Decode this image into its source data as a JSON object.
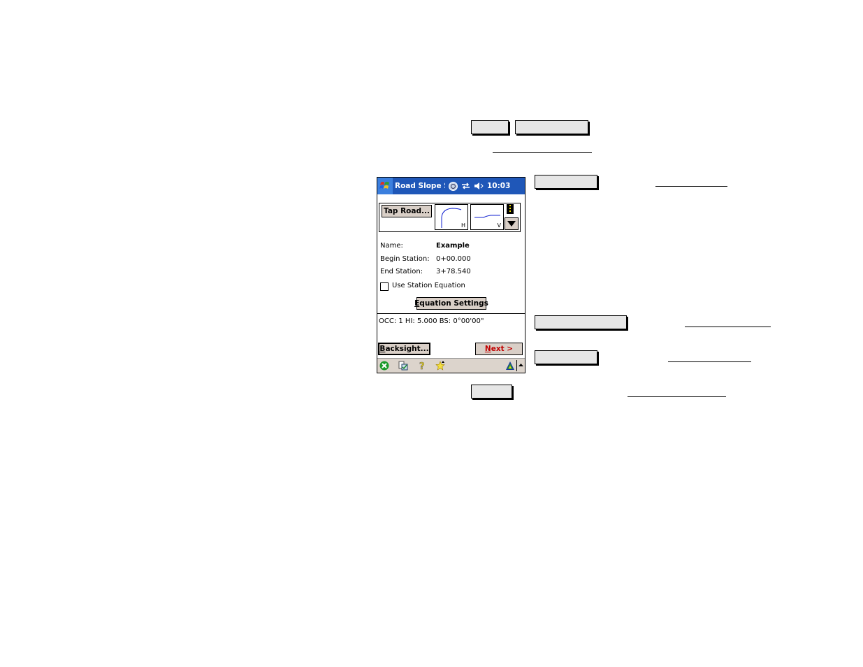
{
  "device": {
    "titlebar": {
      "start_icon": "windows-flag-icon",
      "title": "Road Slope St",
      "status_icons": [
        "connectivity-icon",
        "sync-arrows-icon",
        "speaker-muted-icon"
      ],
      "time": "10:03"
    },
    "road_panel": {
      "tap_road_label": "Tap Road...",
      "horizontal_preview_label": "H",
      "vertical_preview_label": "V",
      "road_icon": "road-icon",
      "dropdown_icon": "triangle-down-icon"
    },
    "fields": {
      "name_label": "Name:",
      "name_value": "Example",
      "begin_station_label": "Begin Station:",
      "begin_station_value": "0+00.000",
      "end_station_label": "End Station:",
      "end_station_value": "3+78.540"
    },
    "use_station_equation": {
      "label": "Use Station Equation",
      "checked": false
    },
    "equation_settings": {
      "accel": "E",
      "rest": "quation Settings"
    },
    "status_line": "OCC: 1  HI: 5.000  BS: 0°00'00\"",
    "backsight": {
      "accel": "B",
      "rest": "acksight..."
    },
    "next": {
      "accel": "N",
      "rest": "ext >"
    },
    "taskbar_icons": [
      "close-icon",
      "clipboard-check-icon",
      "help-icon",
      "favorites-star-icon",
      "survey-logo-icon",
      "up-arrow-icon"
    ]
  },
  "colors": {
    "titlebar": "#1f57b8",
    "button_face": "#d9cfc7",
    "next_text": "#c00000",
    "doc_box": "#e6e6e6"
  }
}
